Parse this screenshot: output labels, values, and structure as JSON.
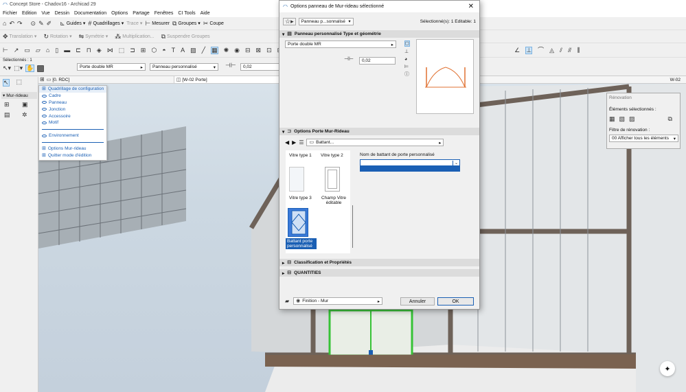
{
  "app": {
    "title": "Concept Store - Chadov16 - Archicad 29"
  },
  "menu": [
    "Fichier",
    "Edition",
    "Vue",
    "Dessin",
    "Documentation",
    "Options",
    "Partage",
    "Fenêtres",
    "CI Tools",
    "Aide"
  ],
  "toolbar1": {
    "guides": "Guides",
    "grids": "Quadrillages",
    "trace": "Trace",
    "measure": "Mesurer",
    "groups": "Groupes",
    "cut": "Coupe"
  },
  "toolbar2": {
    "translation": "Translation",
    "rotation": "Rotation",
    "symmetry": "Symétrie",
    "multiplication": "Multiplication...",
    "suspend": "Suspendre Groupes"
  },
  "infobox": {
    "selected": "Sélectionnés : 1",
    "door_value": "Porte double MR",
    "panel_value": "Panneau personnalisé",
    "thickness": "0,02"
  },
  "tool_panel": {
    "title": "Mur-rideau"
  },
  "tabs": {
    "story": "[0. RDC]",
    "view": "[W-02 Porte]",
    "right": "W-02"
  },
  "popup": {
    "items": [
      "Quadrillage de configuration",
      "Cadre",
      "Panneau",
      "Jonction",
      "Accessoire",
      "Motif",
      "Environnement",
      "Options Mur-rideau",
      "Quitter mode d'édition"
    ]
  },
  "dialog": {
    "title": "Options panneau de Mur-rideau sélectionné",
    "favorite_dropdown": "Panneau p...sonnalisé",
    "selection_info": "Sélectionné(s): 1 Editable: 1",
    "section_geometry": "Panneau personnalisé Type et géométrie",
    "door_field": "Porte double MR",
    "thickness": "0,02",
    "section_options": "Options Porte Mur-Rideau",
    "page_dropdown": "Battant...",
    "thumbs": [
      "Vitre type 1",
      "Vitre type 2",
      "Vitre type 3",
      "Champ Vitre éditable",
      "Battant porte personnalisé"
    ],
    "field_label": "Nom de battant de porte personnalisé",
    "field_value": "",
    "section_classification": "Classification et Propriétés",
    "section_quantities": "QUANTITIES",
    "layer": "Finition - Mur",
    "cancel": "Annuler",
    "ok": "OK"
  },
  "renovation": {
    "title": "Rénovation",
    "selected_label": "Éléments sélectionnés :",
    "filter_label": "Filtre de rénovation :",
    "filter_value": "00 Afficher tous les éléments"
  }
}
